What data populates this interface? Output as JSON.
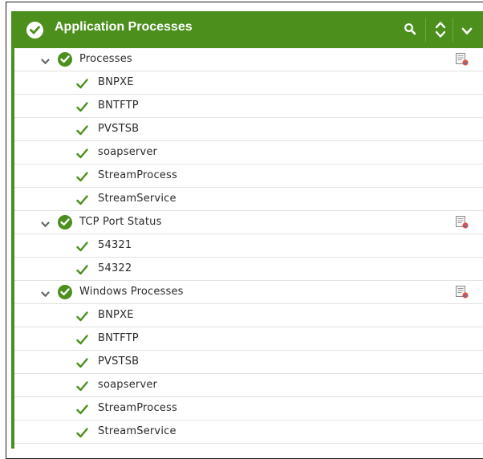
{
  "header": {
    "title": "Application Processes",
    "status_icon": "check-circle-icon",
    "search_icon": "search-icon",
    "sort_icon": "sort-icon",
    "collapse_icon": "chevron-down-icon"
  },
  "colors": {
    "header_bg": "#4c8f1d",
    "status_ok": "#4c8f1d"
  },
  "groups": [
    {
      "label": "Processes",
      "status": "ok",
      "children": [
        "BNPXE",
        "BNTFTP",
        "PVSTSB",
        "soapserver",
        "StreamProcess",
        "StreamService"
      ]
    },
    {
      "label": "TCP Port Status",
      "status": "ok",
      "children": [
        "54321",
        "54322"
      ]
    },
    {
      "label": "Windows Processes",
      "status": "ok",
      "children": [
        "BNPXE",
        "BNTFTP",
        "PVSTSB",
        "soapserver",
        "StreamProcess",
        "StreamService"
      ]
    }
  ]
}
